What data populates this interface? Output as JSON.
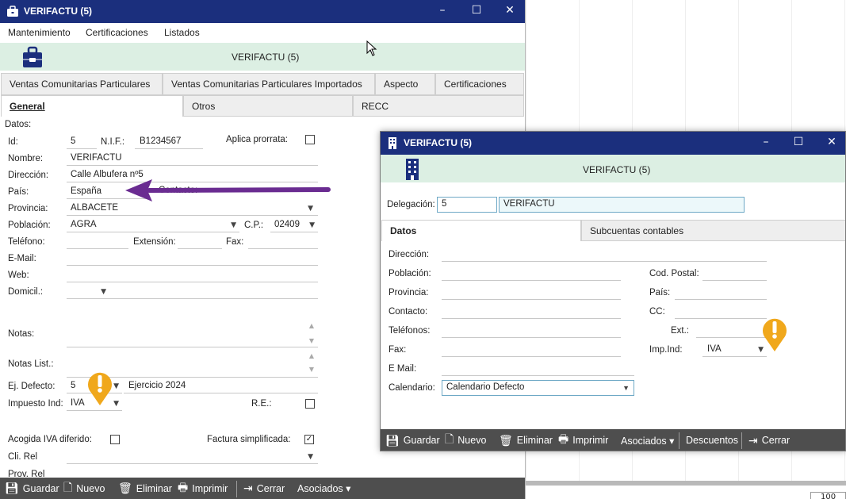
{
  "main_window": {
    "title": "VERIFACTU (5)",
    "controls": {
      "minimize": "–",
      "maximize": "☐",
      "close": "✕"
    },
    "menu": [
      "Mantenimiento",
      "Certificaciones",
      "Listados"
    ],
    "banner_title": "VERIFACTU (5)",
    "tabs_row1": [
      "Ventas Comunitarias Particulares",
      "Ventas Comunitarias Particulares Importados",
      "Aspecto",
      "Certificaciones"
    ],
    "tabs_row2": [
      "General",
      "Otros",
      "RECC"
    ],
    "selected_tab": "General",
    "section_label": "Datos:",
    "fields": {
      "id_label": "Id:",
      "id_value": "5",
      "nif_label": "N.I.F.:",
      "nif_value": "B1234567",
      "prorrata_label": "Aplica prorrata:",
      "nombre_label": "Nombre:",
      "nombre_value": "VERIFACTU",
      "direccion_label": "Dirección:",
      "direccion_value": "Calle Albufera nº5",
      "pais_label": "País:",
      "pais_value": "España",
      "contacto_label": "Contacto:",
      "provincia_label": "Provincia:",
      "provincia_value": "ALBACETE",
      "poblacion_label": "Población:",
      "poblacion_value": "AGRA",
      "cp_label": "C.P.:",
      "cp_value": "02409",
      "telefono_label": "Teléfono:",
      "extension_label": "Extensión:",
      "fax_label": "Fax:",
      "email_label": "E-Mail:",
      "web_label": "Web:",
      "domicil_label": "Domicil.:",
      "notas_label": "Notas:",
      "notas_list_label": "Notas List.:",
      "ejdefecto_label": "Ej. Defecto:",
      "ejdefecto_value": "5",
      "ejercicio_text": "Ejercicio 2024",
      "impuesto_label": "Impuesto Ind:",
      "impuesto_value": "IVA",
      "re_label": "R.E.:",
      "acogida_label": "Acogida IVA diferido:",
      "factura_label": "Factura simplificada:",
      "clirel_label": "Cli. Rel",
      "prov_rel_label": "Prov. Rel"
    },
    "toolbar": {
      "guardar": "Guardar",
      "nuevo": "Nuevo",
      "eliminar": "Eliminar",
      "imprimir": "Imprimir",
      "cerrar": "Cerrar",
      "asociados": "Asociados ▾"
    }
  },
  "dialog": {
    "title": "VERIFACTU (5)",
    "controls": {
      "minimize": "–",
      "maximize": "☐",
      "close": "✕"
    },
    "banner_title": "VERIFACTU (5)",
    "delegacion_label": "Delegación:",
    "delegacion_code": "5",
    "delegacion_name": "VERIFACTU",
    "tabs": [
      "Datos",
      "Subcuentas contables"
    ],
    "selected_tab": "Datos",
    "fields": {
      "direccion_label": "Dirección:",
      "poblacion_label": "Población:",
      "provincia_label": "Provincia:",
      "contacto_label": "Contacto:",
      "telefonos_label": "Teléfonos:",
      "fax_label": "Fax:",
      "email_label": "E Mail:",
      "calendario_label": "Calendario:",
      "calendario_value": "Calendario Defecto",
      "codpostal_label": "Cod. Postal:",
      "pais_label": "País:",
      "cc_label": "CC:",
      "ext_label": "Ext.:",
      "impind_label": "Imp.Ind:",
      "impind_value": "IVA"
    },
    "toolbar": {
      "guardar": "Guardar",
      "nuevo": "Nuevo",
      "eliminar": "Eliminar",
      "imprimir": "Imprimir",
      "asociados": "Asociados ▾",
      "descuentos": "Descuentos",
      "cerrar": "Cerrar"
    }
  },
  "background": {
    "zoom_value": "100"
  },
  "colors": {
    "titlebar": "#1b2f7d",
    "banner": "#dcefe3",
    "toolbar": "#4e4e4e",
    "arrow": "#6a2c91",
    "marker": "#f0a81c"
  },
  "icons": [
    "briefcase-icon",
    "building-icon",
    "save-icon",
    "new-doc-icon",
    "trash-icon",
    "printer-icon",
    "exit-icon",
    "warning-marker-icon",
    "arrow-annotation-icon",
    "mouse-cursor-icon"
  ]
}
